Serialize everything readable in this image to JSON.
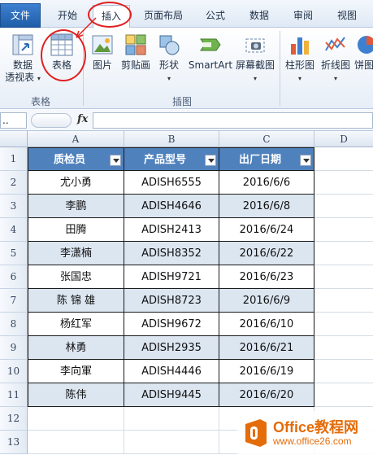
{
  "ribbon_tabs": [
    {
      "label": "文件",
      "id": "file"
    },
    {
      "label": "开始",
      "id": "home"
    },
    {
      "label": "插入",
      "id": "insert"
    },
    {
      "label": "页面布局",
      "id": "layout"
    },
    {
      "label": "公式",
      "id": "formulas"
    },
    {
      "label": "数据",
      "id": "data"
    },
    {
      "label": "审阅",
      "id": "review"
    },
    {
      "label": "视图",
      "id": "view"
    }
  ],
  "ribbon": {
    "pivot_line1": "数据",
    "pivot_line2": "透视表",
    "table": "表格",
    "picture": "图片",
    "clipart": "剪贴画",
    "shapes": "形状",
    "smartart": "SmartArt",
    "screenshot": "屏幕截图",
    "column_chart": "柱形图",
    "line_chart": "折线图",
    "pie_chart": "饼图",
    "group_tables": "表格",
    "group_illustrations": "插图",
    "caret": "▾"
  },
  "formula_bar": {
    "namebox": "..",
    "fx": "fx"
  },
  "columns": [
    "A",
    "B",
    "C",
    "D"
  ],
  "rows": [
    "1",
    "2",
    "3",
    "4",
    "5",
    "6",
    "7",
    "8",
    "9",
    "10",
    "11",
    "12",
    "13"
  ],
  "table": {
    "headers": [
      "质检员",
      "产品型号",
      "出厂日期"
    ],
    "rows": [
      [
        "尤小勇",
        "ADISH6555",
        "2016/6/6"
      ],
      [
        "李鹏",
        "ADISH4646",
        "2016/6/8"
      ],
      [
        "田腾",
        "ADISH2413",
        "2016/6/24"
      ],
      [
        "李潇楠",
        "ADISH8352",
        "2016/6/22"
      ],
      [
        "张国忠",
        "ADISH9721",
        "2016/6/23"
      ],
      [
        "陈 锦 雄",
        "ADISH8723",
        "2016/6/9"
      ],
      [
        "杨红军",
        "ADISH9672",
        "2016/6/10"
      ],
      [
        "林勇",
        "ADISH2935",
        "2016/6/21"
      ],
      [
        "李向軍",
        "ADISH4446",
        "2016/6/19"
      ],
      [
        "陈伟",
        "ADISH9445",
        "2016/6/20"
      ]
    ],
    "header_color": "#4f81bd",
    "band_color": "#dce6f1"
  },
  "watermark": {
    "line1": "Office教程网",
    "line2": "www.office26.com"
  },
  "colors": {
    "annotation": "#e02020",
    "accent": "#1f5ea8"
  }
}
